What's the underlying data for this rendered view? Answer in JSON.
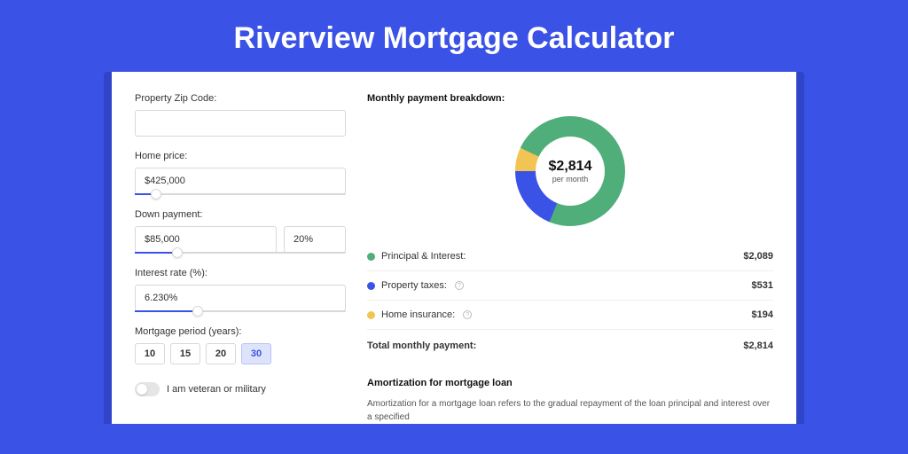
{
  "title": "Riverview Mortgage Calculator",
  "form": {
    "zip_label": "Property Zip Code:",
    "zip_value": "",
    "home_price_label": "Home price:",
    "home_price_value": "$425,000",
    "down_payment_label": "Down payment:",
    "down_payment_value": "$85,000",
    "down_payment_pct": "20%",
    "interest_label": "Interest rate (%):",
    "interest_value": "6.230%",
    "period_label": "Mortgage period (years):",
    "periods": [
      "10",
      "15",
      "20",
      "30"
    ],
    "period_active": "30",
    "veteran_label": "I am veteran or military"
  },
  "breakdown": {
    "title": "Monthly payment breakdown:",
    "center_amount": "$2,814",
    "center_sub": "per month",
    "items": [
      {
        "label": "Principal & Interest:",
        "value": "$2,089",
        "color": "#4fae79",
        "info": false
      },
      {
        "label": "Property taxes:",
        "value": "$531",
        "color": "#3b52e6",
        "info": true
      },
      {
        "label": "Home insurance:",
        "value": "$194",
        "color": "#f1c453",
        "info": true
      }
    ],
    "total_label": "Total monthly payment:",
    "total_value": "$2,814"
  },
  "amortization": {
    "title": "Amortization for mortgage loan",
    "text": "Amortization for a mortgage loan refers to the gradual repayment of the loan principal and interest over a specified"
  },
  "chart_data": {
    "type": "pie",
    "title": "Monthly payment breakdown",
    "series": [
      {
        "name": "Principal & Interest",
        "value": 2089,
        "color": "#4fae79"
      },
      {
        "name": "Property taxes",
        "value": 531,
        "color": "#3b52e6"
      },
      {
        "name": "Home insurance",
        "value": 194,
        "color": "#f1c453"
      }
    ],
    "total": 2814,
    "angles_deg": [
      267.3,
      67.9,
      24.8
    ]
  }
}
